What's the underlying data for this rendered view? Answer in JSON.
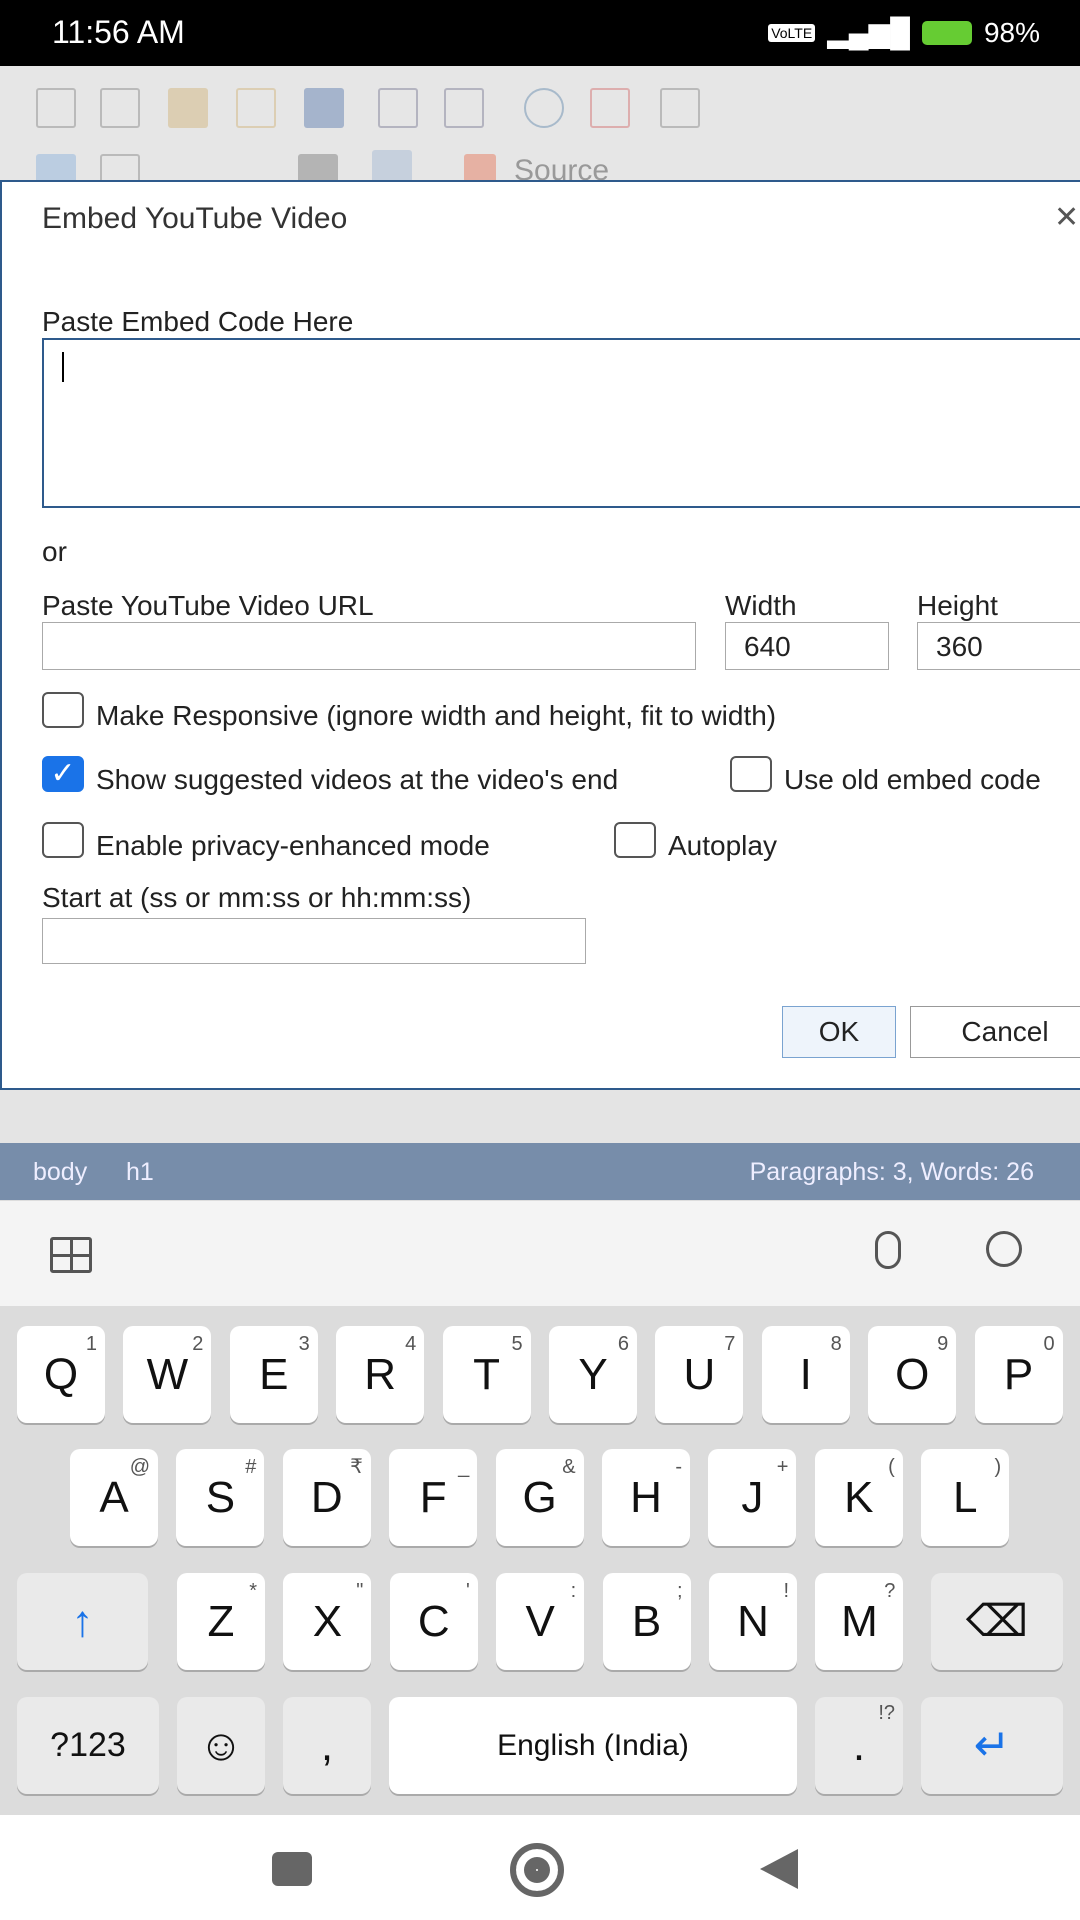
{
  "status_bar": {
    "time": "11:56 AM",
    "battery": "98%",
    "network": "VoLTE"
  },
  "toolbar": {
    "source_label": "Source"
  },
  "dialog": {
    "title": "Embed YouTube Video",
    "embed_label": "Paste Embed Code Here",
    "embed_value": "",
    "or": "or",
    "url_label": "Paste YouTube Video URL",
    "url_value": "",
    "width_label": "Width",
    "width_value": "640",
    "height_label": "Height",
    "height_value": "360",
    "responsive_label": "Make Responsive (ignore width and height, fit to width)",
    "suggested_label": "Show suggested videos at the video's end",
    "old_embed_label": "Use old embed code",
    "privacy_label": "Enable privacy-enhanced mode",
    "autoplay_label": "Autoplay",
    "start_label": "Start at (ss or mm:ss or hh:mm:ss)",
    "start_value": "",
    "ok": "OK",
    "cancel": "Cancel",
    "check": "✓",
    "close": "✕"
  },
  "path_bar": {
    "items": [
      "body",
      "h1"
    ],
    "stats": "Paragraphs: 3, Words: 26"
  },
  "keyboard": {
    "row1": [
      [
        "Q",
        "1"
      ],
      [
        "W",
        "2"
      ],
      [
        "E",
        "3"
      ],
      [
        "R",
        "4"
      ],
      [
        "T",
        "5"
      ],
      [
        "Y",
        "6"
      ],
      [
        "U",
        "7"
      ],
      [
        "I",
        "8"
      ],
      [
        "O",
        "9"
      ],
      [
        "P",
        "0"
      ]
    ],
    "row2": [
      [
        "A",
        "@"
      ],
      [
        "S",
        "#"
      ],
      [
        "D",
        "₹"
      ],
      [
        "F",
        "_"
      ],
      [
        "G",
        "&"
      ],
      [
        "H",
        "-"
      ],
      [
        "J",
        "+"
      ],
      [
        "K",
        "("
      ],
      [
        "L",
        ")"
      ]
    ],
    "row3": [
      [
        "Z",
        "*"
      ],
      [
        "X",
        "\""
      ],
      [
        "C",
        "'"
      ],
      [
        "V",
        ":"
      ],
      [
        "B",
        ";"
      ],
      [
        "N",
        "!"
      ],
      [
        "M",
        "?"
      ]
    ],
    "sym": "?123",
    "comma": ",",
    "space": "English (India)",
    "period": ".",
    "period_hint": "!?",
    "shift": "↑",
    "backspace": "⌫",
    "enter": "↵",
    "emoji": "☺"
  }
}
